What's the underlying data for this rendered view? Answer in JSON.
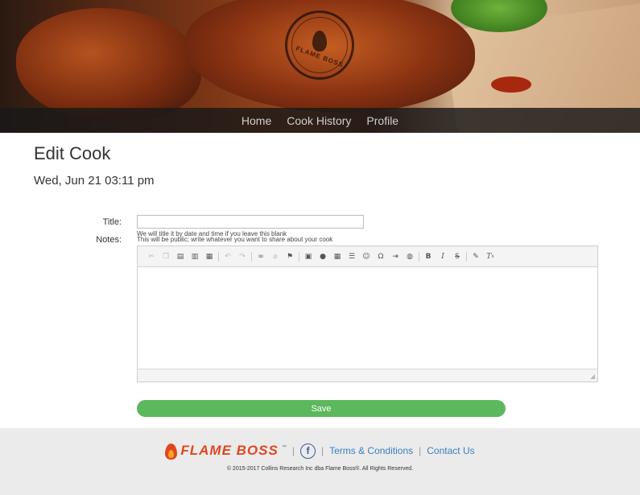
{
  "nav": {
    "items": [
      "Home",
      "Cook History",
      "Profile"
    ]
  },
  "hero": {
    "seal_text": "FLAME BOSS"
  },
  "page": {
    "title": "Edit Cook",
    "date": "Wed, Jun 21 03:11 pm"
  },
  "form": {
    "title_label": "Title:",
    "title_value": "",
    "title_hint": "We will title it by date and time if you leave this blank",
    "notes_label": "Notes:",
    "notes_hint": "This will be public; write whatever you want to share about your cook",
    "save_label": "Save"
  },
  "toolbar": {
    "buttons": [
      "cut-icon",
      "copy-icon",
      "paste-icon",
      "paste-text-icon",
      "paste-word-icon",
      "undo-icon",
      "redo-icon",
      "link-icon",
      "unlink-icon",
      "anchor-icon",
      "image-icon",
      "flash-icon",
      "table-icon",
      "horizontal-line-icon",
      "smiley-icon",
      "special-char-icon",
      "page-break-icon",
      "iframe-icon",
      "bold-icon",
      "italic-icon",
      "strike-icon",
      "format-painter-icon",
      "remove-format-icon"
    ]
  },
  "footer": {
    "brand": "FLAME BOSS",
    "tm": "™",
    "terms": "Terms & Conditions",
    "contact": "Contact Us",
    "copyright": "© 2015-2017 Collins Research Inc dba Flame Boss®. All Rights Reserved."
  },
  "colors": {
    "save_green": "#5cb85c",
    "brand_orange": "#e1461f",
    "link_blue": "#3a7fc1",
    "nav_bg": "#191919"
  }
}
